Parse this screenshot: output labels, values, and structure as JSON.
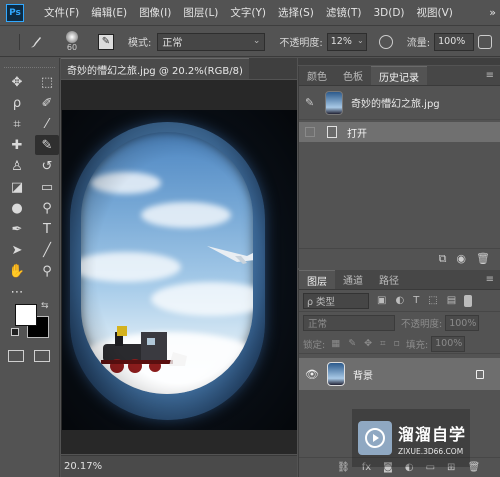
{
  "app": {
    "logo": "Ps"
  },
  "menu": [
    "文件(F)",
    "编辑(E)",
    "图像(I)",
    "图层(L)",
    "文字(Y)",
    "选择(S)",
    "滤镜(T)",
    "3D(D)",
    "视图(V)"
  ],
  "menu_more": "»",
  "options": {
    "brush_size": "60",
    "mode_label": "模式:",
    "mode_value": "正常",
    "opacity_label": "不透明度:",
    "opacity_value": "12%",
    "flow_label": "流量:",
    "flow_value": "100%"
  },
  "document": {
    "tab_title": "奇妙的懵幻之旅.jpg @ 20.2%(RGB/8)",
    "close": "×",
    "zoom_status": "20.17%"
  },
  "history_panel": {
    "tabs": [
      "颜色",
      "色板",
      "历史记录"
    ],
    "active_tab": "历史记录",
    "snapshot_name": "奇妙的懵幻之旅.jpg",
    "states": [
      "打开"
    ]
  },
  "layers_panel": {
    "tabs": [
      "图层",
      "通道",
      "路径"
    ],
    "active_tab": "图层",
    "filter_kind": "ρ 类型",
    "blend_mode": "正常",
    "opacity_label": "不透明度:",
    "opacity_value": "100%",
    "lock_label": "锁定:",
    "fill_label": "填充:",
    "fill_value": "100%",
    "layers": [
      {
        "name": "背景",
        "visible": true,
        "locked": true
      }
    ]
  },
  "watermark": {
    "name": "溜溜自学",
    "url": "ZIXUE.3D66.COM"
  },
  "colors": {
    "foreground": "#ffffff",
    "background": "#000000",
    "accent": "#31a8ff"
  }
}
